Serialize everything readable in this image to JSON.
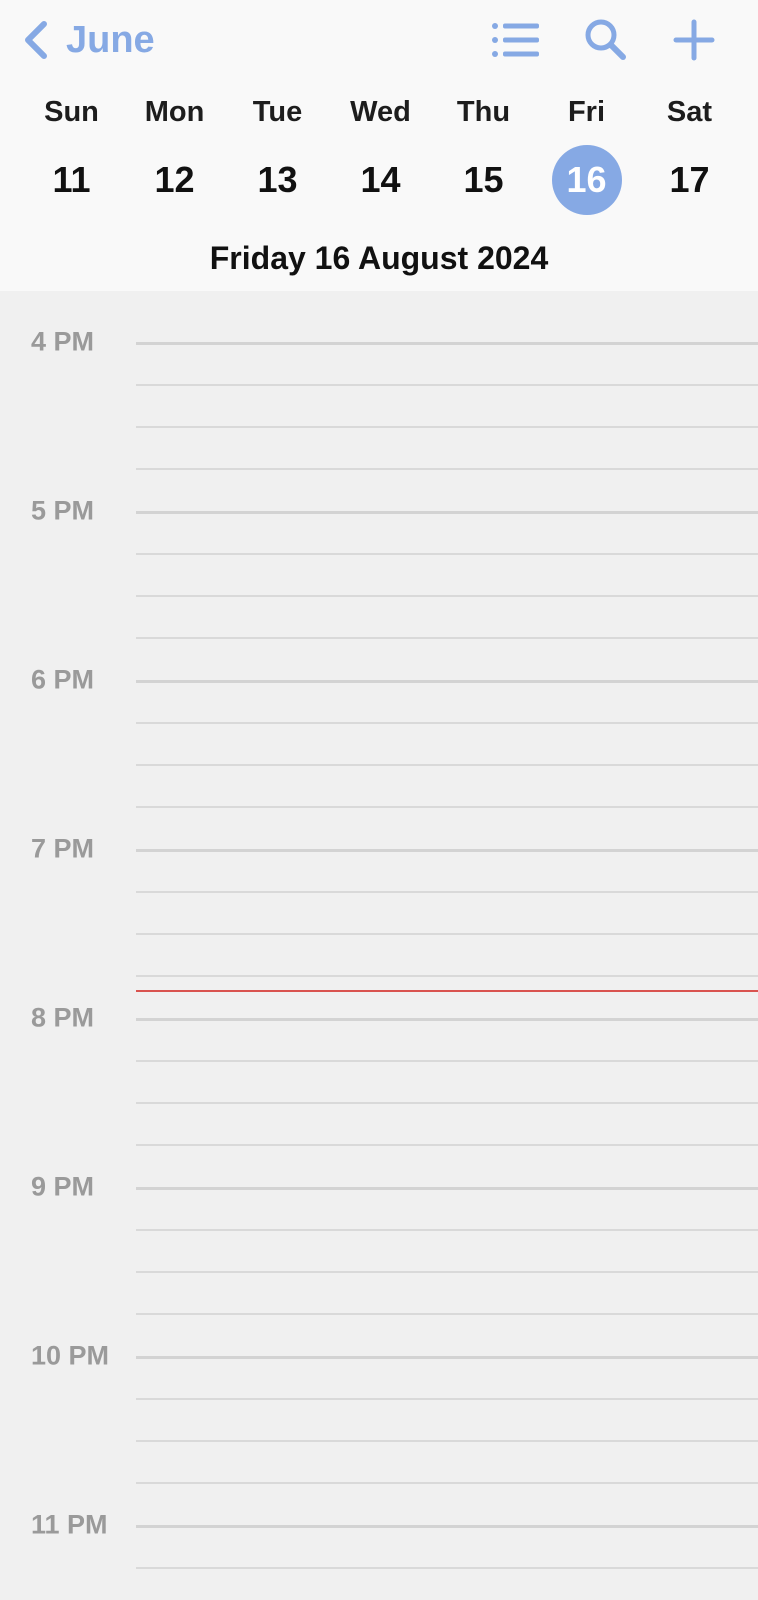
{
  "header": {
    "back_label": "June",
    "weekdays": [
      "Sun",
      "Mon",
      "Tue",
      "Wed",
      "Thu",
      "Fri",
      "Sat"
    ],
    "dates": [
      "11",
      "12",
      "13",
      "14",
      "15",
      "16",
      "17"
    ],
    "selected_date": "16",
    "full_date": "Friday 16 August 2024"
  },
  "toolbar": {
    "icons": [
      "list-icon",
      "search-icon",
      "add-icon"
    ]
  },
  "timeline": {
    "hours": [
      "4 PM",
      "5 PM",
      "6 PM",
      "7 PM",
      "8 PM",
      "9 PM",
      "10 PM",
      "11 PM"
    ]
  },
  "colors": {
    "accent": "#86a9e4",
    "current_time_line": "#d9534f"
  }
}
